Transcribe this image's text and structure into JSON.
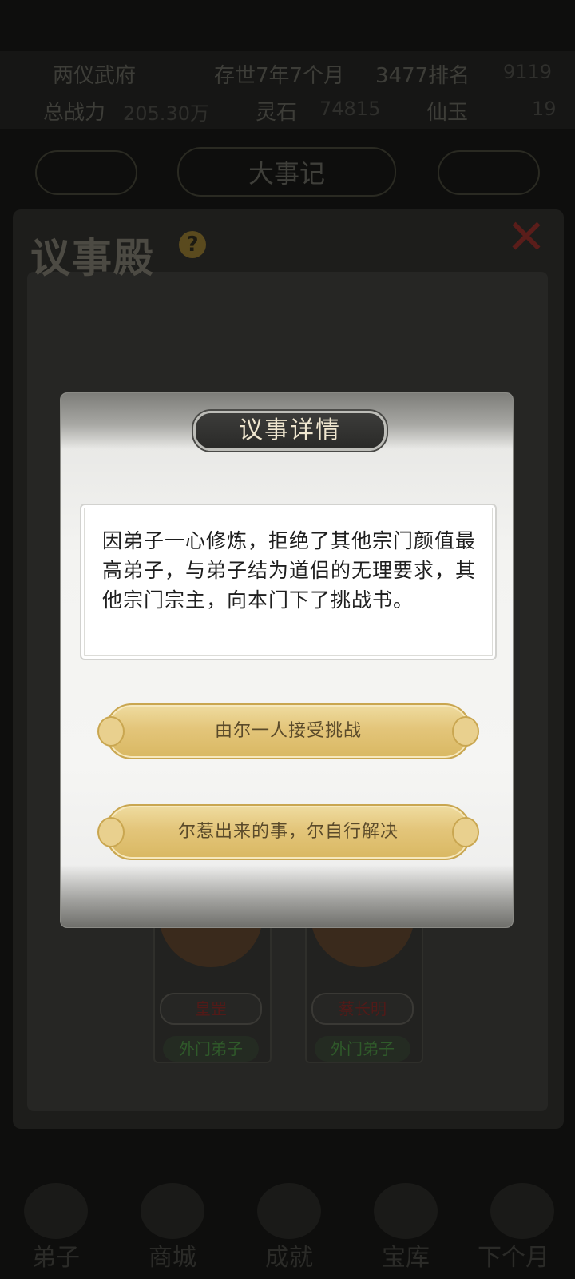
{
  "top_bar": {
    "sect_name": "两仪武府",
    "time": "存世7年7个月",
    "rank": "3477排名",
    "currency": "9119",
    "power_label": "总战力",
    "power_value": "205.30万",
    "resource_label": "灵石",
    "resource_value": "74815",
    "extra_label": "仙玉",
    "extra_value": "19"
  },
  "tabs": {
    "left": "",
    "center": "大事记",
    "right": ""
  },
  "hall": {
    "title": "议事殿",
    "help_icon": "question-icon",
    "close_icon": "close-icon",
    "disciples": [
      {
        "name": "皇罡",
        "rank": "外门弟子"
      },
      {
        "name": "蔡长明",
        "rank": "外门弟子"
      }
    ]
  },
  "bottom_nav": [
    "弟子",
    "商城",
    "成就",
    "宝库",
    "下个月"
  ],
  "modal": {
    "title": "议事详情",
    "description": "因弟子一心修炼，拒绝了其他宗门颜值最高弟子，与弟子结为道侣的无理要求，其他宗门宗主，向本门下了挑战书。",
    "option_1": "由尔一人接受挑战",
    "option_2": "尔惹出来的事，尔自行解决"
  },
  "colors": {
    "button_gold": "#e3c57a",
    "title_pill": "#2f2f2d",
    "overlay": "#0e0e0d"
  }
}
